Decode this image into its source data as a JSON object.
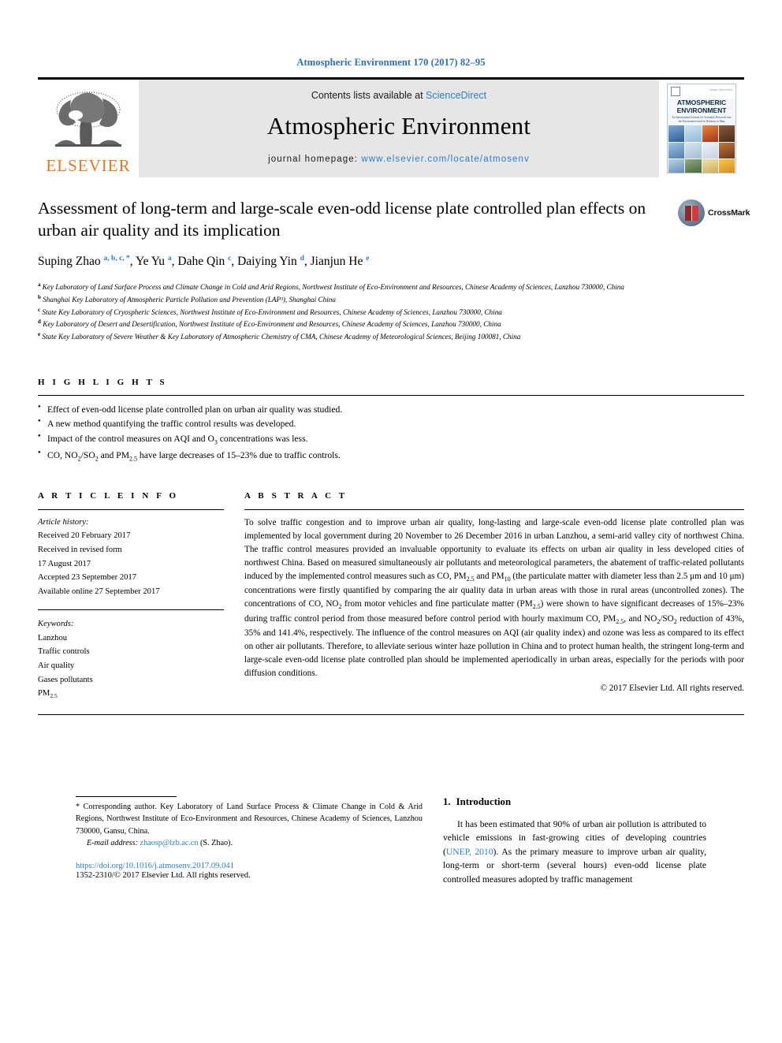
{
  "running_head": "Atmospheric Environment 170 (2017) 82–95",
  "masthead": {
    "contents_prefix": "Contents lists available at ",
    "contents_link": "ScienceDirect",
    "journal_title": "Atmospheric Environment",
    "homepage_prefix": "journal homepage: ",
    "homepage_url": "www.elsevier.com/locate/atmosenv",
    "publisher_wordmark": "ELSEVIER",
    "publisher_logo_icon": "elsevier-tree-icon",
    "cover": {
      "title_line1": "ATMOSPHERIC",
      "title_line2": "ENVIRONMENT",
      "subtitle": "An International Journal for Scientific Research into the Environment and its Relation to Man",
      "code": "ISSN 1352-2310"
    }
  },
  "article": {
    "title": "Assessment of long-term and large-scale even-odd license plate controlled plan effects on urban air quality and its implication",
    "authors": [
      {
        "name": "Suping Zhao",
        "marks": "a, b, c, *"
      },
      {
        "name": "Ye Yu",
        "marks": "a"
      },
      {
        "name": "Dahe Qin",
        "marks": "c"
      },
      {
        "name": "Daiying Yin",
        "marks": "d"
      },
      {
        "name": "Jianjun He",
        "marks": "e"
      }
    ],
    "crossmark_label": "CrossMark",
    "crossmark_icon": "crossmark-logo-icon",
    "affiliations": [
      {
        "mark": "a",
        "text": "Key Laboratory of Land Surface Process and Climate Change in Cold and Arid Regions, Northwest Institute of Eco-Environment and Resources, Chinese Academy of Sciences, Lanzhou 730000, China"
      },
      {
        "mark": "b",
        "text": "Shanghai Key Laboratory of Atmospheric Particle Pollution and Prevention (LAP³), Shanghai China"
      },
      {
        "mark": "c",
        "text": "State Key Laboratory of Cryospheric Sciences, Northwest Institute of Eco-Environment and Resources, Chinese Academy of Sciences, Lanzhou 730000, China"
      },
      {
        "mark": "d",
        "text": "Key Laboratory of Desert and Desertification, Northwest Institute of Eco-Environment and Resources, Chinese Academy of Sciences, Lanzhou 730000, China"
      },
      {
        "mark": "e",
        "text": "State Key Laboratory of Severe Weather & Key Laboratory of Atmospheric Chemistry of CMA, Chinese Academy of Meteorological Sciences, Beijing 100081, China"
      }
    ]
  },
  "highlights": {
    "label": "H I G H L I G H T S",
    "items": [
      "Effect of even-odd license plate controlled plan on urban air quality was studied.",
      "A new method quantifying the traffic control results was developed.",
      "Impact of the control measures on AQI and O<sub>3</sub> concentrations was less.",
      "CO, NO<sub>2</sub>/SO<sub>2</sub> and PM<sub>2.5</sub> have large decreases of 15–23% due to traffic controls."
    ]
  },
  "article_info": {
    "label": "A R T I C L E  I N F O",
    "history_label": "Article history:",
    "history": [
      "Received 20 February 2017",
      "Received in revised form",
      "17 August 2017",
      "Accepted 23 September 2017",
      "Available online 27 September 2017"
    ],
    "keywords_label": "Keywords:",
    "keywords": [
      "Lanzhou",
      "Traffic controls",
      "Air quality",
      "Gases pollutants",
      "PM<sub>2.5</sub>"
    ]
  },
  "abstract": {
    "label": "A B S T R A C T",
    "text": "To solve traffic congestion and to improve urban air quality, long-lasting and large-scale even-odd license plate controlled plan was implemented by local government during 20 November to 26 December 2016 in urban Lanzhou, a semi-arid valley city of northwest China. The traffic control measures provided an invaluable opportunity to evaluate its effects on urban air quality in less developed cities of northwest China. Based on measured simultaneously air pollutants and meteorological parameters, the abatement of traffic-related pollutants induced by the implemented control measures such as CO, PM<sub>2.5</sub> and PM<sub>10</sub> (the particulate matter with diameter less than 2.5 μm and 10 μm) concentrations were firstly quantified by comparing the air quality data in urban areas with those in rural areas (uncontrolled zones). The concentrations of CO, NO<sub>2</sub> from motor vehicles and fine particulate matter (PM<sub>2.5</sub>) were shown to have significant decreases of 15%–23% during traffic control period from those measured before control period with hourly maximum CO, PM<sub>2.5</sub>, and NO<sub>2</sub>/SO<sub>2</sub> reduction of 43%, 35% and 141.4%, respectively. The influence of the control measures on AQI (air quality index) and ozone was less as compared to its effect on other air pollutants. Therefore, to alleviate serious winter haze pollution in China and to protect human health, the stringent long-term and large-scale even-odd license plate controlled plan should be implemented aperiodically in urban areas, especially for the periods with poor diffusion conditions.",
    "copyright": "© 2017 Elsevier Ltd. All rights reserved."
  },
  "footer": {
    "corresponding_marker": "*",
    "corresponding_text": "Corresponding author. Key Laboratory of Land Surface Process & Climate Change in Cold & Arid Regions, Northwest Institute of Eco-Environment and Resources, Chinese Academy of Sciences, Lanzhou 730000, Gansu, China.",
    "email_label": "E-mail address:",
    "email": "zhaosp@lzb.ac.cn",
    "email_owner": "(S. Zhao).",
    "doi": "https://doi.org/10.1016/j.atmosenv.2017.09.041",
    "issn_line": "1352-2310/© 2017 Elsevier Ltd. All rights reserved."
  },
  "introduction": {
    "number": "1.",
    "heading": "Introduction",
    "paragraph_part1": "It has been estimated that 90% of urban air pollution is attributed to vehicle emissions in fast-growing cities of developing countries (",
    "citation": "UNEP, 2010",
    "paragraph_part2": "). As the primary measure to improve urban air quality, long-term or short-term (several hours) even-odd license plate controlled measures adopted by traffic management"
  },
  "colors": {
    "link_blue": "#2a7fc9",
    "header_blue": "#2a6ebb",
    "elsevier_orange": "#E87722",
    "masthead_gray": "#e6e6e6"
  }
}
